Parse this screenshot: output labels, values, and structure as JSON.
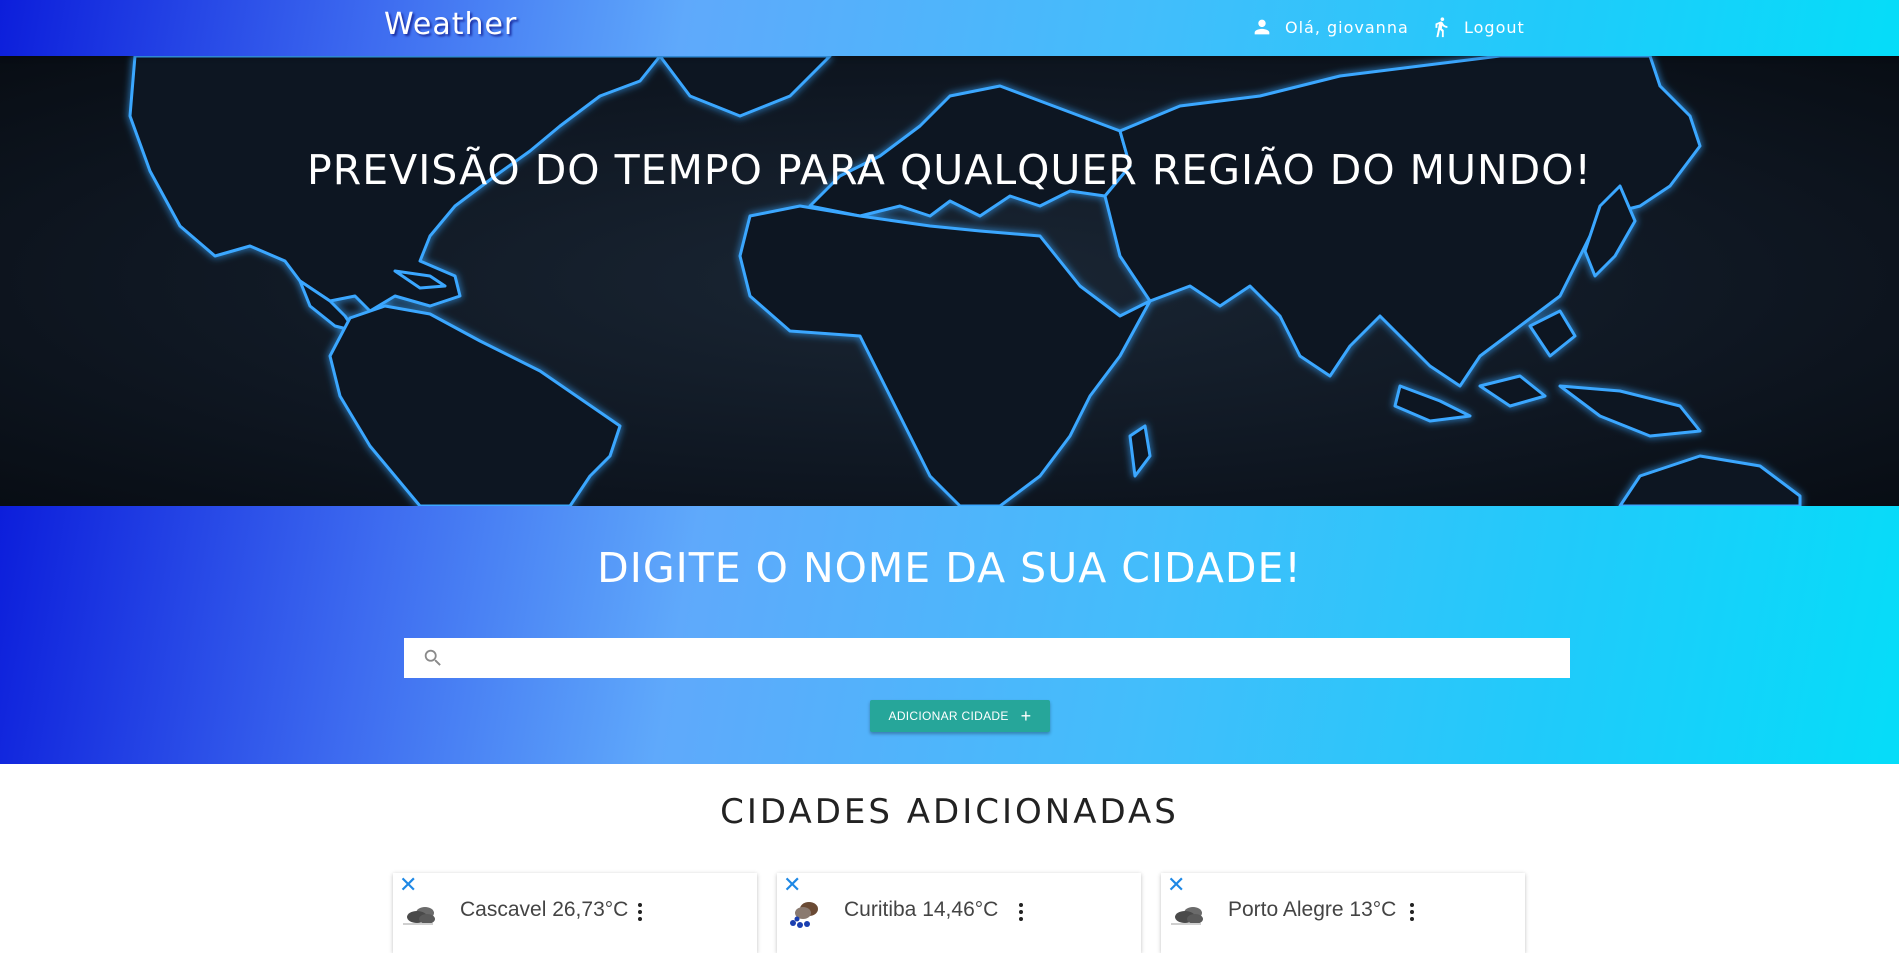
{
  "navbar": {
    "brand": "Weather",
    "user_label": "Olá, giovanna",
    "logout_label": "Logout",
    "user_icon": "person-icon",
    "logout_icon": "walking-person-icon"
  },
  "hero": {
    "title": "PREVISÃO DO TEMPO PARA QUALQUER REGIÃO DO MUNDO!"
  },
  "search": {
    "heading": "DIGITE O NOME DA SUA CIDADE!",
    "value": "",
    "placeholder": "",
    "add_button_label": "ADICIONAR CIDADE",
    "add_button_icon": "+"
  },
  "cities": {
    "heading": "CIDADES ADICIONADAS",
    "items": [
      {
        "label": "Cascavel 26,73°C",
        "icon": "cloudy-icon"
      },
      {
        "label": "Curitiba 14,46°C",
        "icon": "rain-icon"
      },
      {
        "label": "Porto Alegre 13°C",
        "icon": "cloudy-icon"
      }
    ]
  },
  "colors": {
    "gradient_start": "#0c1edb",
    "gradient_mid": "#5fa9fb",
    "gradient_end": "#05ddf9",
    "map_glow": "#36a8ff",
    "button": "#26a69a",
    "close_x": "#1e88e5"
  }
}
